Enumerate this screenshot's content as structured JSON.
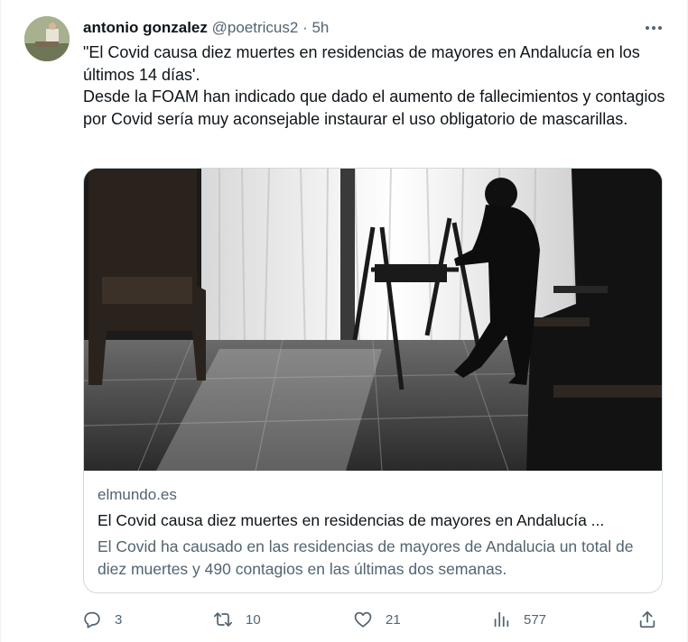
{
  "tweet": {
    "author_name": "antonio gonzalez",
    "handle": "@poetricus2",
    "separator": "·",
    "time": "5h",
    "text_line1": "\"El Covid causa diez muertes en residencias de mayores en Andalucía en los últimos 14 días'.",
    "text_line2": "Desde la FOAM han indicado que dado el aumento de fallecimientos y contagios por Covid sería muy aconsejable instaurar el uso obligatorio de mascarillas."
  },
  "card": {
    "domain": "elmundo.es",
    "title": "El Covid causa diez muertes en residencias de mayores en Andalucía ...",
    "description": "El Covid ha causado en las residencias de mayores de Andalucia un total de diez muertes y 490 contagios en las últimas dos semanas."
  },
  "actions": {
    "replies": "3",
    "retweets": "10",
    "likes": "21",
    "views": "577"
  },
  "icons": [
    "more-icon",
    "reply-icon",
    "retweet-icon",
    "like-icon",
    "views-icon",
    "share-icon"
  ],
  "colors": {
    "text": "#0f1419",
    "secondary": "#536471",
    "border": "#cfd9de"
  }
}
